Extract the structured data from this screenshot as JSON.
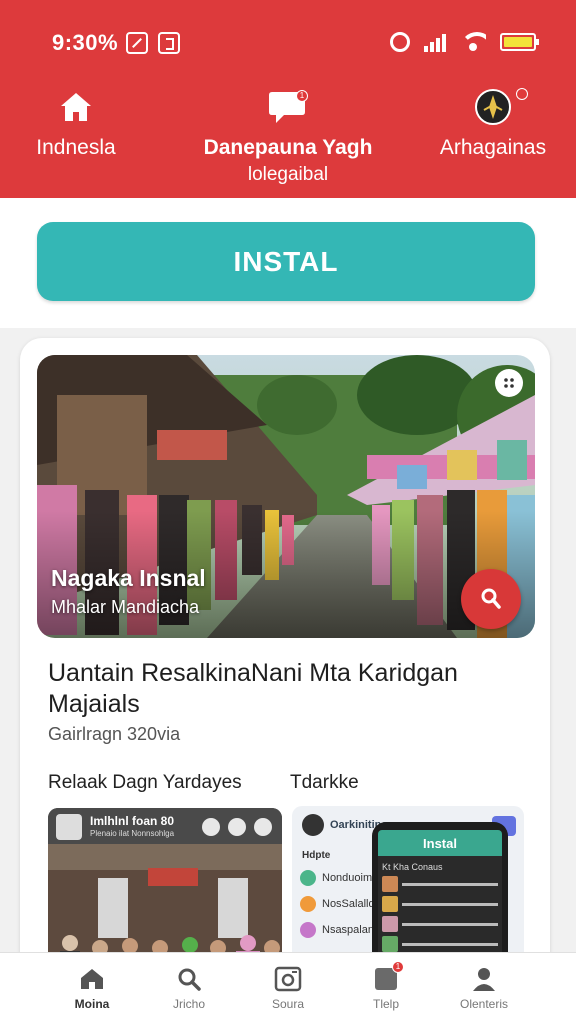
{
  "status_bar": {
    "time": "9:30%"
  },
  "header": {
    "background_color": "#dd3a3c",
    "nav": [
      {
        "label": "Indnesla",
        "icon": "home-icon"
      },
      {
        "label": "Danepauna Yagh",
        "sublabel": "lolegaibal",
        "icon": "chat-bubble-icon",
        "badge": "1"
      },
      {
        "label": "Arhagainas",
        "icon": "compass-icon",
        "badge": ""
      }
    ]
  },
  "install_button": {
    "label": "INSTAL",
    "color": "#34b7b5"
  },
  "card": {
    "hero": {
      "title": "Nagaka Insnal",
      "subtitle": "Mhalar Mandiacha"
    },
    "title": "Uantain ResalkinaNani Mta Karidgan Majaials",
    "meta": "Gairlragn 320via",
    "section_left": "Relaak Dagn Yardayes",
    "section_right": "Tdarkke",
    "thumb_left": {
      "title": "Imlhlnl foan 80",
      "subtitle": "Plenaio ilat Nonnsohlga"
    },
    "thumb_right": {
      "header": "Oarkinitinan",
      "label": "Hdpte",
      "rows": [
        "Nonduoimlin",
        "NosSalalld",
        "Nsaspalanuou"
      ],
      "phone_title": "Instal",
      "phone_subtitle": "Kt Kha Conaus"
    }
  },
  "bottom_nav": [
    {
      "label": "Moina",
      "icon": "home-icon",
      "active": true
    },
    {
      "label": "Jricho",
      "icon": "search-icon",
      "active": false
    },
    {
      "label": "Soura",
      "icon": "camera-icon",
      "active": false
    },
    {
      "label": "Tlelp",
      "icon": "inbox-icon",
      "active": false,
      "badge": "1"
    },
    {
      "label": "Olenteris",
      "icon": "person-icon",
      "active": false
    }
  ]
}
